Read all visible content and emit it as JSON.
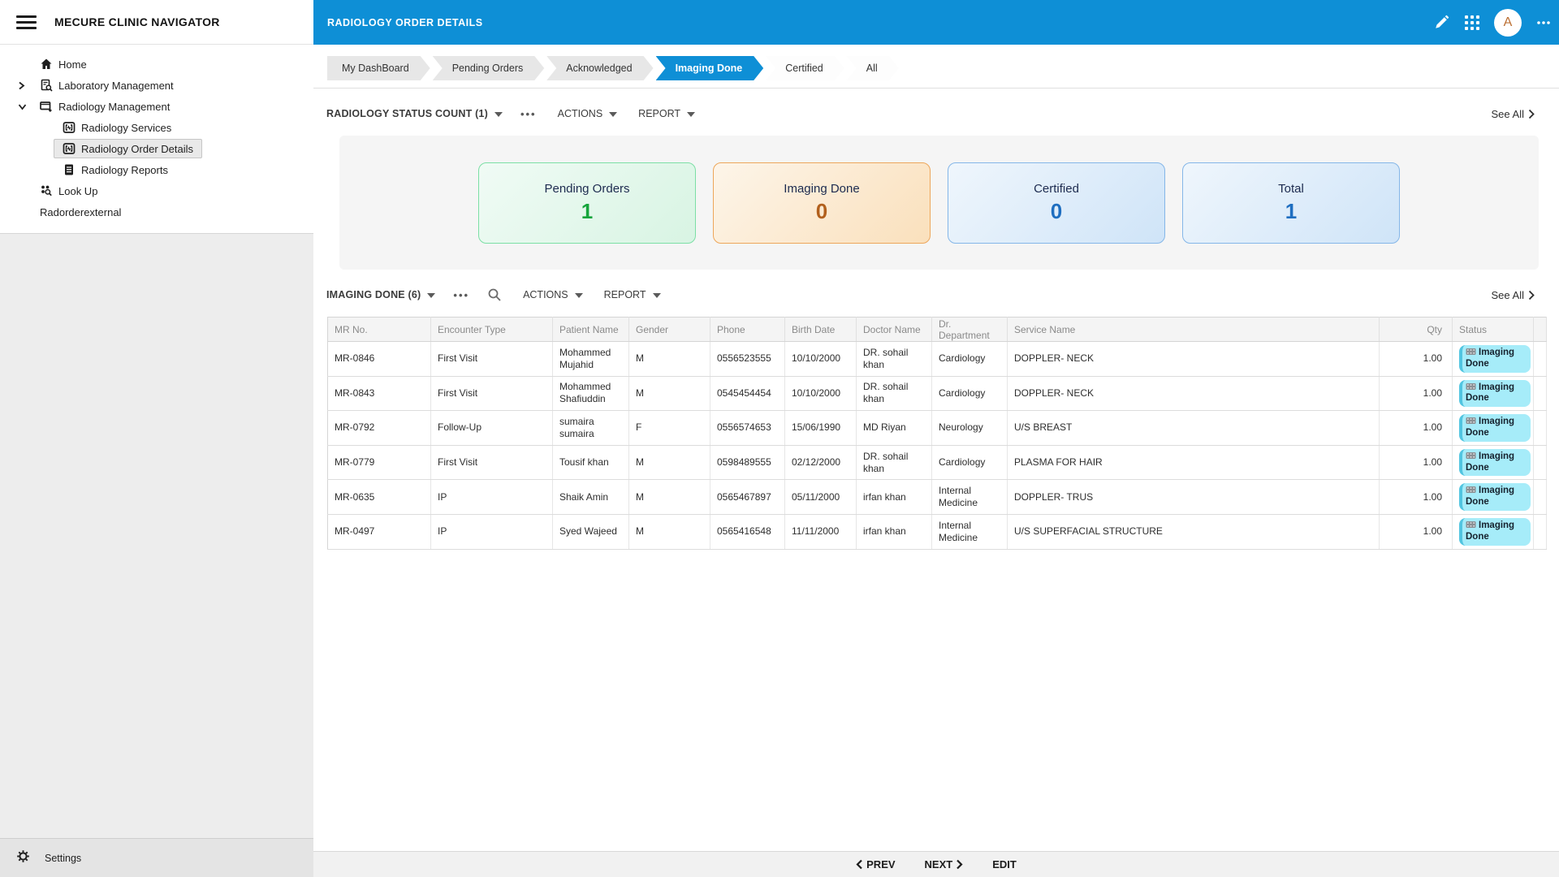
{
  "app": {
    "title": "MECURE CLINIC NAVIGATOR"
  },
  "sidebar": {
    "items": [
      {
        "label": "Home",
        "icon": "home-icon",
        "expander": "none",
        "indent": false,
        "selected": false
      },
      {
        "label": "Laboratory Management",
        "icon": "lab-icon",
        "expander": "chevron-right",
        "indent": false,
        "selected": false
      },
      {
        "label": "Radiology Management",
        "icon": "radiology-folder-icon",
        "expander": "chevron-down",
        "indent": false,
        "selected": false
      },
      {
        "label": "Radiology Services",
        "icon": "scan-icon",
        "expander": "none",
        "indent": true,
        "selected": false
      },
      {
        "label": "Radiology Order Details",
        "icon": "scan-icon",
        "expander": "none",
        "indent": true,
        "selected": true
      },
      {
        "label": "Radiology Reports",
        "icon": "report-icon",
        "expander": "none",
        "indent": true,
        "selected": false
      },
      {
        "label": "Look Up",
        "icon": "lookup-icon",
        "expander": "none",
        "indent": false,
        "selected": false
      },
      {
        "label": "Radorderexternal",
        "icon": "none",
        "expander": "none",
        "indent": false,
        "selected": false
      }
    ],
    "settings_label": "Settings"
  },
  "topbar": {
    "title": "RADIOLOGY ORDER DETAILS",
    "avatar_letter": "A"
  },
  "tabs": [
    {
      "label": "My DashBoard",
      "state": "default"
    },
    {
      "label": "Pending Orders",
      "state": "default"
    },
    {
      "label": "Acknowledged",
      "state": "default"
    },
    {
      "label": "Imaging Done",
      "state": "active"
    },
    {
      "label": "Certified",
      "state": "plain"
    },
    {
      "label": "All",
      "state": "plain"
    }
  ],
  "status_section": {
    "title": "RADIOLOGY STATUS COUNT (1)",
    "actions_label": "ACTIONS",
    "report_label": "REPORT",
    "see_all": "See All",
    "cards": [
      {
        "label": "Pending Orders",
        "value": "1",
        "theme": "green"
      },
      {
        "label": "Imaging Done",
        "value": "0",
        "theme": "orange"
      },
      {
        "label": "Certified",
        "value": "0",
        "theme": "blue"
      },
      {
        "label": "Total",
        "value": "1",
        "theme": "blue"
      }
    ]
  },
  "orders_section": {
    "title": "IMAGING DONE (6)",
    "actions_label": "ACTIONS",
    "report_label": "REPORT",
    "see_all": "See All",
    "table": {
      "columns": [
        "MR No.",
        "Encounter Type",
        "Patient Name",
        "Gender",
        "Phone",
        "Birth Date",
        "Doctor Name",
        "Dr. Department",
        "Service Name",
        "Qty",
        "Status"
      ],
      "rows": [
        {
          "mr_no": "MR-0846",
          "encounter_type": "First Visit",
          "patient_name": "Mohammed Mujahid",
          "gender": "M",
          "phone": "0556523555",
          "birth_date": "10/10/2000",
          "doctor_name": "DR. sohail khan",
          "department": "Cardiology",
          "service_name": "DOPPLER- NECK",
          "qty": "1.00",
          "status": "Imaging Done"
        },
        {
          "mr_no": "MR-0843",
          "encounter_type": "First Visit",
          "patient_name": "Mohammed Shafiuddin",
          "gender": "M",
          "phone": "0545454454",
          "birth_date": "10/10/2000",
          "doctor_name": "DR. sohail khan",
          "department": "Cardiology",
          "service_name": "DOPPLER- NECK",
          "qty": "1.00",
          "status": "Imaging Done"
        },
        {
          "mr_no": "MR-0792",
          "encounter_type": "Follow-Up",
          "patient_name": "sumaira sumaira",
          "gender": "F",
          "phone": "0556574653",
          "birth_date": "15/06/1990",
          "doctor_name": "MD Riyan",
          "department": "Neurology",
          "service_name": "U/S BREAST",
          "qty": "1.00",
          "status": "Imaging Done"
        },
        {
          "mr_no": "MR-0779",
          "encounter_type": "First Visit",
          "patient_name": "Tousif khan",
          "gender": "M",
          "phone": "0598489555",
          "birth_date": "02/12/2000",
          "doctor_name": "DR. sohail khan",
          "department": "Cardiology",
          "service_name": "PLASMA FOR HAIR",
          "qty": "1.00",
          "status": "Imaging Done"
        },
        {
          "mr_no": "MR-0635",
          "encounter_type": "IP",
          "patient_name": "Shaik Amin",
          "gender": "M",
          "phone": "0565467897",
          "birth_date": "05/11/2000",
          "doctor_name": "irfan khan",
          "department": "Internal Medicine",
          "service_name": "DOPPLER- TRUS",
          "qty": "1.00",
          "status": "Imaging Done"
        },
        {
          "mr_no": "MR-0497",
          "encounter_type": "IP",
          "patient_name": "Syed Wajeed",
          "gender": "M",
          "phone": "0565416548",
          "birth_date": "11/11/2000",
          "doctor_name": "irfan khan",
          "department": "Internal Medicine",
          "service_name": "U/S SUPERFACIAL STRUCTURE",
          "qty": "1.00",
          "status": "Imaging Done"
        }
      ]
    }
  },
  "footer": {
    "prev_label": "PREV",
    "next_label": "NEXT",
    "edit_label": "EDIT"
  },
  "colors": {
    "topbar_blue": "#0e8fd6",
    "badge_bg": "#a6ecf9",
    "badge_accent": "#52c5e0",
    "card_green_value": "#16a53c",
    "card_orange_value": "#b2601d",
    "card_blue_value": "#1e6ec0"
  }
}
